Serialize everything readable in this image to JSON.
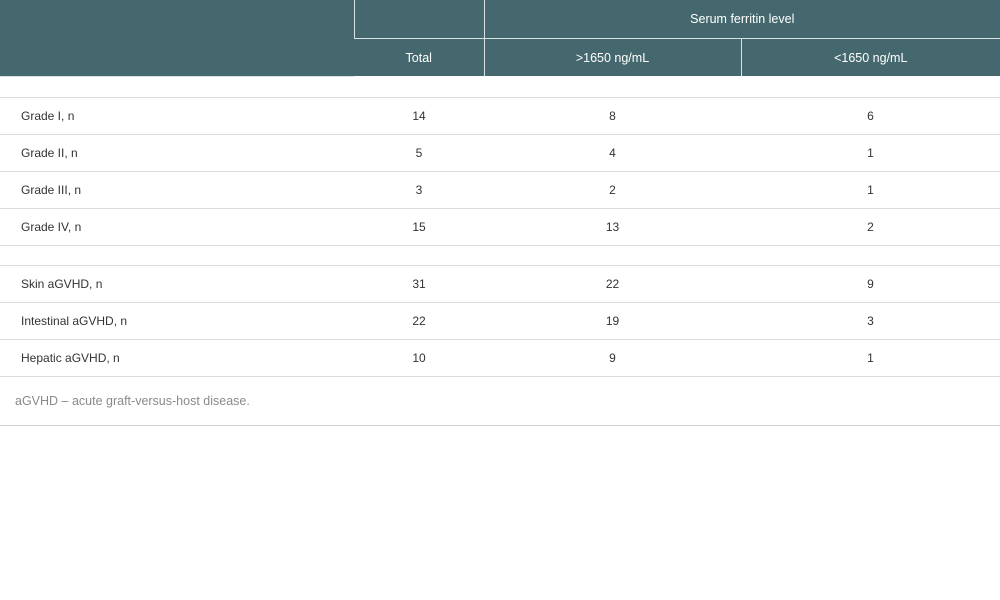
{
  "header": {
    "group_label": "Serum ferritin level",
    "col_total": "Total",
    "col_high": ">1650 ng/mL",
    "col_low": "<1650 ng/mL"
  },
  "rows": [
    {
      "label": "Grade I, n",
      "total": "14",
      "high": "8",
      "low": "6"
    },
    {
      "label": "Grade II, n",
      "total": "5",
      "high": "4",
      "low": "1"
    },
    {
      "label": "Grade III, n",
      "total": "3",
      "high": "2",
      "low": "1"
    },
    {
      "label": "Grade IV, n",
      "total": "15",
      "high": "13",
      "low": "2"
    },
    {
      "label": "Skin aGVHD, n",
      "total": "31",
      "high": "22",
      "low": "9"
    },
    {
      "label": "Intestinal aGVHD, n",
      "total": "22",
      "high": "19",
      "low": "3"
    },
    {
      "label": "Hepatic aGVHD, n",
      "total": "10",
      "high": "9",
      "low": "1"
    }
  ],
  "footnote": "aGVHD – acute graft-versus-host disease."
}
